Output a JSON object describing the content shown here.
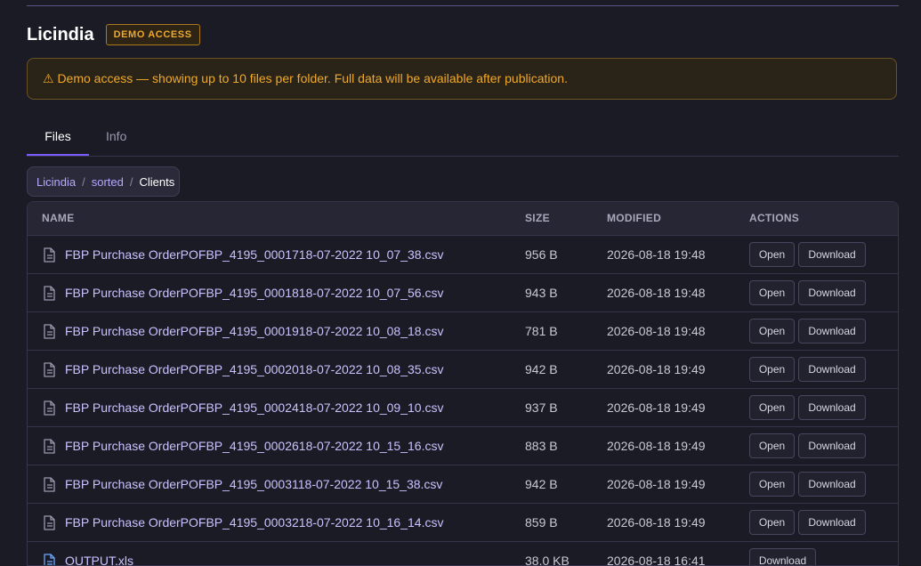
{
  "project": {
    "title": "Licindia",
    "badge": "DEMO ACCESS"
  },
  "notice": {
    "icon": "warning-icon",
    "text": "⚠ Demo access — showing up to 10 files per folder. Full data will be available after publication."
  },
  "tabs": [
    {
      "label": "Files",
      "active": true
    },
    {
      "label": "Info",
      "active": false
    }
  ],
  "breadcrumb": {
    "items": [
      "Licindia",
      "sorted",
      "Clients"
    ],
    "separator": "/"
  },
  "table": {
    "headers": {
      "name": "NAME",
      "size": "SIZE",
      "modified": "MODIFIED",
      "actions": "ACTIONS"
    },
    "actions": {
      "open": "Open",
      "download": "Download"
    },
    "rows": [
      {
        "name": "FBP Purchase OrderPOFBP_4195_0001718-07-2022 10_07_38.csv",
        "size": "956 B",
        "modified": "2026-08-18 19:48",
        "open": true
      },
      {
        "name": "FBP Purchase OrderPOFBP_4195_0001818-07-2022 10_07_56.csv",
        "size": "943 B",
        "modified": "2026-08-18 19:48",
        "open": true
      },
      {
        "name": "FBP Purchase OrderPOFBP_4195_0001918-07-2022 10_08_18.csv",
        "size": "781 B",
        "modified": "2026-08-18 19:48",
        "open": true
      },
      {
        "name": "FBP Purchase OrderPOFBP_4195_0002018-07-2022 10_08_35.csv",
        "size": "942 B",
        "modified": "2026-08-18 19:49",
        "open": true
      },
      {
        "name": "FBP Purchase OrderPOFBP_4195_0002418-07-2022 10_09_10.csv",
        "size": "937 B",
        "modified": "2026-08-18 19:49",
        "open": true
      },
      {
        "name": "FBP Purchase OrderPOFBP_4195_0002618-07-2022 10_15_16.csv",
        "size": "883 B",
        "modified": "2026-08-18 19:49",
        "open": true
      },
      {
        "name": "FBP Purchase OrderPOFBP_4195_0003118-07-2022 10_15_38.csv",
        "size": "942 B",
        "modified": "2026-08-18 19:49",
        "open": true
      },
      {
        "name": "FBP Purchase OrderPOFBP_4195_0003218-07-2022 10_16_14.csv",
        "size": "859 B",
        "modified": "2026-08-18 19:49",
        "open": true
      },
      {
        "name": "OUTPUT.xls",
        "size": "38.0 KB",
        "modified": "2026-08-18 16:41",
        "open": false,
        "icon_color": "#6ea8ff"
      }
    ]
  },
  "colors": {
    "accent": "#7c5cff",
    "warning": "#f0a92a",
    "link": "#b7a8ff",
    "background": "#1b1b25"
  }
}
